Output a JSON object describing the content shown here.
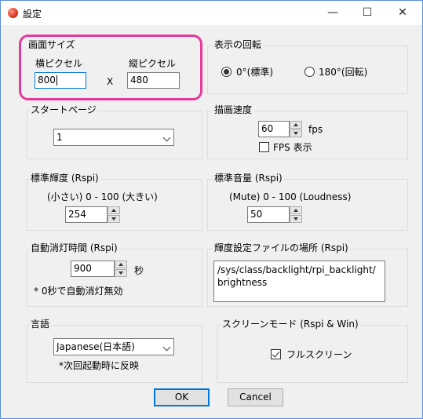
{
  "window": {
    "title": "設定",
    "minimize": "—",
    "maximize": "☐",
    "close": "✕"
  },
  "screen_size": {
    "legend": "画面サイズ",
    "width_label": "横ピクセル",
    "height_label": "縦ピクセル",
    "width_value": "800",
    "separator": "X",
    "height_value": "480"
  },
  "rotation": {
    "legend": "表示の回転",
    "options": [
      {
        "label": "0°(標準)",
        "checked": true
      },
      {
        "label": "180°(回転)",
        "checked": false
      }
    ]
  },
  "start_page": {
    "legend": "スタートページ",
    "value": "1"
  },
  "draw_speed": {
    "legend": "描画速度",
    "value": "60",
    "unit": "fps",
    "fps_display_label": "FPS 表示",
    "fps_display_checked": false
  },
  "brightness": {
    "legend": "標準輝度 (Rspi)",
    "range_text": "(小さい) 0 - 100 (大きい)",
    "value": "254"
  },
  "volume": {
    "legend": "標準音量 (Rspi)",
    "range_text": "(Mute) 0 - 100 (Loudness)",
    "value": "50"
  },
  "auto_off": {
    "legend": "自動消灯時間 (Rspi)",
    "value": "900",
    "unit": "秒",
    "note": "* 0秒で自動消灯無効"
  },
  "brightness_file": {
    "legend": "輝度設定ファイルの場所 (Rspi)",
    "path": "/sys/class/backlight/rpi_backlight/brightness"
  },
  "language": {
    "legend": "言語",
    "value": "Japanese(日本語)",
    "note": "*次回起動時に反映"
  },
  "screen_mode": {
    "legend": "スクリーンモード (Rspi & Win)",
    "fullscreen_label": "フルスクリーン",
    "fullscreen_checked": true
  },
  "buttons": {
    "ok": "OK",
    "cancel": "Cancel"
  },
  "colors": {
    "highlight": "#e63a9b",
    "focus": "#0078d7"
  }
}
